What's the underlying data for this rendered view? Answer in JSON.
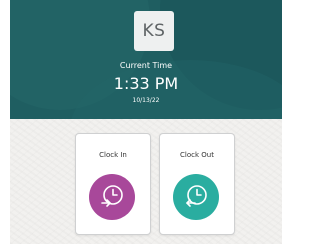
{
  "header": {
    "avatar_initials": "KS",
    "time_label": "Current Time",
    "time_value": "1:33 PM",
    "date_value": "10/13/22"
  },
  "actions": {
    "clock_in": {
      "label": "Clock In",
      "icon": "clock-in-icon",
      "color": "#a8489a"
    },
    "clock_out": {
      "label": "Clock Out",
      "icon": "clock-out-icon",
      "color": "#2aada0"
    }
  },
  "colors": {
    "header_bg": "#1f5e61",
    "body_bg": "#f2f1ef"
  }
}
